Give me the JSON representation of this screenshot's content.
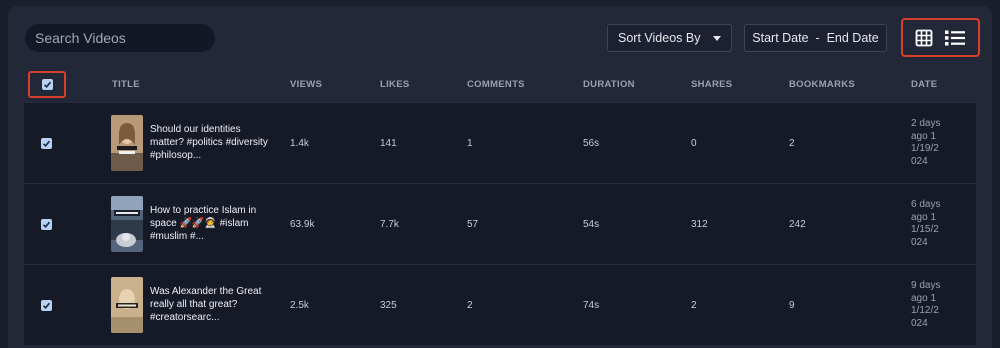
{
  "search": {
    "placeholder": "Search Videos"
  },
  "sort": {
    "label": "Sort Videos By"
  },
  "date_range": {
    "label": "Start Date  -  End Date"
  },
  "columns": [
    "TITLE",
    "VIEWS",
    "LIKES",
    "COMMENTS",
    "DURATION",
    "SHARES",
    "BOOKMARKS",
    "DATE"
  ],
  "rows": [
    {
      "title": "Should our identities matter? #politics #diversity #philosop...",
      "views": "1.4k",
      "likes": "141",
      "comments": "1",
      "duration": "56s",
      "shares": "0",
      "bookmarks": "2",
      "date_ago": "2 days ago",
      "date": "11/19/2024"
    },
    {
      "title": "How to practice Islam in space 🚀🚀🧑‍🚀 #islam #muslim #...",
      "views": "63.9k",
      "likes": "7.7k",
      "comments": "57",
      "duration": "54s",
      "shares": "312",
      "bookmarks": "242",
      "date_ago": "6 days ago",
      "date": "11/15/2024"
    },
    {
      "title": "Was Alexander the Great really all that great? #creatorsearc...",
      "views": "2.5k",
      "likes": "325",
      "comments": "2",
      "duration": "74s",
      "shares": "2",
      "bookmarks": "9",
      "date_ago": "9 days ago",
      "date": "11/12/2024"
    }
  ],
  "colors": {
    "accent_outline": "#d8402d",
    "checkbox": "#b7d2f5",
    "panel": "#232839",
    "row_bg": "#161a27"
  }
}
